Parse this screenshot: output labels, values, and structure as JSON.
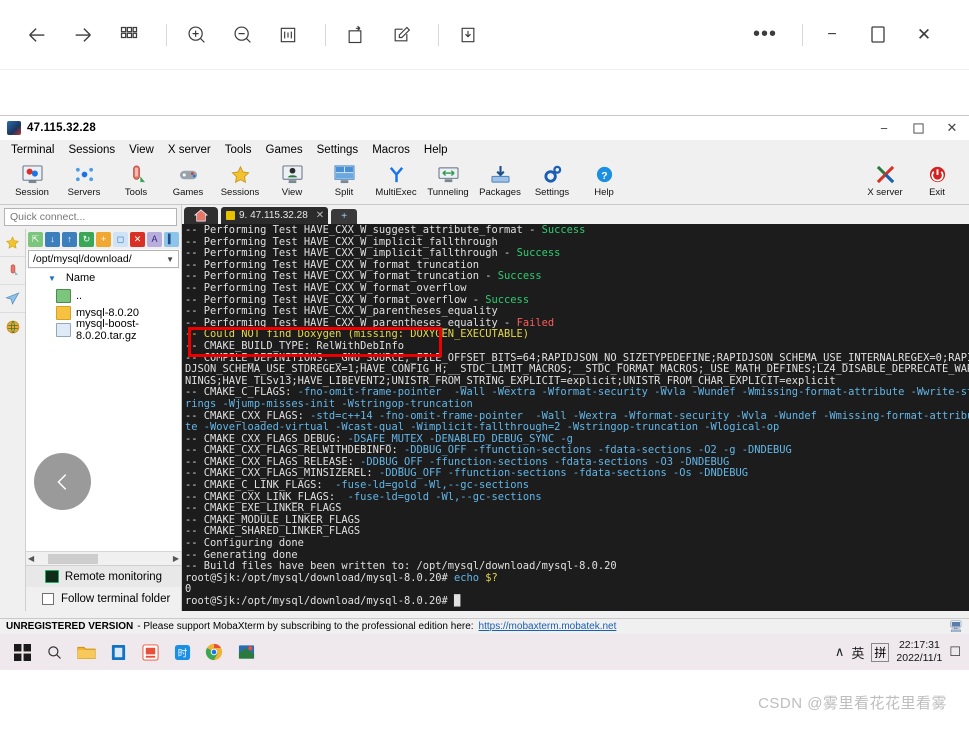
{
  "viewer_toolbar": {
    "icons": [
      {
        "name": "back-icon",
        "glyph": "←"
      },
      {
        "name": "forward-icon",
        "glyph": "→"
      },
      {
        "name": "grid-view-icon",
        "glyph": "grid"
      },
      {
        "name": "zoom-in-icon",
        "glyph": "zoom-in"
      },
      {
        "name": "zoom-out-icon",
        "glyph": "zoom-out"
      },
      {
        "name": "actual-size-icon",
        "glyph": "fit"
      },
      {
        "name": "rotate-icon",
        "glyph": "rotate"
      },
      {
        "name": "edit-icon",
        "glyph": "edit"
      },
      {
        "name": "save-icon",
        "glyph": "download"
      }
    ],
    "more_label": "•••",
    "minimize_label": "−",
    "maximize_label": "❐",
    "close_label": "✕"
  },
  "moba": {
    "window_title": "47.115.32.28",
    "window_controls": {
      "minimize": "−",
      "restore": "❐",
      "close": "✕"
    },
    "menus": [
      "Terminal",
      "Sessions",
      "View",
      "X server",
      "Tools",
      "Games",
      "Settings",
      "Macros",
      "Help"
    ],
    "ribbon": [
      {
        "label": "Session",
        "icon": "session-icon"
      },
      {
        "label": "Servers",
        "icon": "servers-icon"
      },
      {
        "label": "Tools",
        "icon": "tools-icon"
      },
      {
        "label": "Games",
        "icon": "games-icon"
      },
      {
        "label": "Sessions",
        "icon": "sessions-star-icon"
      },
      {
        "label": "View",
        "icon": "view-icon"
      },
      {
        "label": "Split",
        "icon": "split-icon"
      },
      {
        "label": "MultiExec",
        "icon": "multiexec-icon"
      },
      {
        "label": "Tunneling",
        "icon": "tunneling-icon"
      },
      {
        "label": "Packages",
        "icon": "packages-icon"
      },
      {
        "label": "Settings",
        "icon": "settings-gear-icon"
      },
      {
        "label": "Help",
        "icon": "help-icon"
      }
    ],
    "ribbon_right": [
      {
        "label": "X server",
        "icon": "xserver-icon"
      },
      {
        "label": "Exit",
        "icon": "exit-power-icon"
      }
    ]
  },
  "sidebar": {
    "quick_connect_placeholder": "Quick connect...",
    "vertical_tabs": [
      {
        "name": "bookmarks-star-icon",
        "glyph": "★"
      },
      {
        "name": "tools-thermometer-icon",
        "glyph": "⌇"
      },
      {
        "name": "sftp-plane-icon",
        "glyph": "➤"
      },
      {
        "name": "globe-icon",
        "glyph": "●"
      }
    ],
    "sftp_tool_icons": [
      {
        "name": "up-folder-icon",
        "color": "#4caf50"
      },
      {
        "name": "download-icon",
        "color": "#2b6cb0"
      },
      {
        "name": "upload-icon",
        "color": "#2b6cb0"
      },
      {
        "name": "refresh-icon",
        "color": "#3aa757"
      },
      {
        "name": "new-folder-icon",
        "color": "#f0a830"
      },
      {
        "name": "new-file-icon",
        "color": "#cfe3f7"
      },
      {
        "name": "delete-icon",
        "color": "#d93025"
      },
      {
        "name": "text-mode-icon",
        "color": "#8e7cc3"
      },
      {
        "name": "binary-mode-icon",
        "color": "#5b9bd5"
      }
    ],
    "path": "/opt/mysql/download/",
    "column_header": "Name",
    "files": [
      {
        "name": "..",
        "type": "parent"
      },
      {
        "name": "mysql-8.0.20",
        "type": "folder"
      },
      {
        "name": "mysql-boost-8.0.20.tar.gz",
        "type": "archive"
      }
    ],
    "remote_monitoring_label": "Remote monitoring",
    "follow_terminal_folder_label": "Follow terminal folder",
    "follow_terminal_folder_checked": false,
    "back_button_glyph": "‹"
  },
  "terminal": {
    "tab_label": "9. 47.115.32.28",
    "tab_close": "✕",
    "tab_add": "+",
    "lines": [
      [
        {
          "t": "-- Performing Test HAVE_CXX_W_suggest_attribute_format - ",
          "c": ""
        },
        {
          "t": "Success",
          "c": "g"
        }
      ],
      [
        {
          "t": "-- Performing Test HAVE_CXX_W_implicit_fallthrough",
          "c": ""
        }
      ],
      [
        {
          "t": "-- Performing Test HAVE_CXX_W_implicit_fallthrough - ",
          "c": ""
        },
        {
          "t": "Success",
          "c": "g"
        }
      ],
      [
        {
          "t": "-- Performing Test HAVE_CXX_W_format_truncation",
          "c": ""
        }
      ],
      [
        {
          "t": "-- Performing Test HAVE_CXX_W_format_truncation - ",
          "c": ""
        },
        {
          "t": "Success",
          "c": "g"
        }
      ],
      [
        {
          "t": "-- Performing Test HAVE_CXX_W_format_overflow",
          "c": ""
        }
      ],
      [
        {
          "t": "-- Performing Test HAVE_CXX_W_format_overflow - ",
          "c": ""
        },
        {
          "t": "Success",
          "c": "g"
        }
      ],
      [
        {
          "t": "-- Performing Test HAVE_CXX_W_parentheses_equality",
          "c": ""
        }
      ],
      [
        {
          "t": "-- Performing Test HAVE_CXX_W_parentheses_equality - ",
          "c": ""
        },
        {
          "t": "Failed",
          "c": "r"
        }
      ],
      [
        {
          "t": "-- Could NOT find Doxygen (missing: DOXYGEN_EXECUTABLE)",
          "c": "y"
        }
      ],
      [
        {
          "t": "-- CMAKE_BUILD_TYPE: RelWithDebInfo",
          "c": ""
        }
      ],
      [
        {
          "t": "-- COMPILE_DEFINITIONS: _GNU_SOURCE;_FILE_OFFSET_BITS=64;RAPIDJSON_NO_SIZETYPEDEFINE;RAPIDJSON_SCHEMA_USE_INTERNALREGEX=0;RAPI",
          "c": ""
        }
      ],
      [
        {
          "t": "DJSON_SCHEMA_USE_STDREGEX=1;HAVE_CONFIG_H;__STDC_LIMIT_MACROS;__STDC_FORMAT_MACROS;_USE_MATH_DEFINES;LZ4_DISABLE_DEPRECATE_WAR",
          "c": ""
        }
      ],
      [
        {
          "t": "NINGS;HAVE_TLSv13;HAVE_LIBEVENT2;UNISTR_FROM_STRING_EXPLICIT=explicit;UNISTR_FROM_CHAR_EXPLICIT=explicit",
          "c": ""
        }
      ],
      [
        {
          "t": "-- CMAKE_C_FLAGS: ",
          "c": ""
        },
        {
          "t": "-fno-omit-frame-pointer  -Wall -Wextra -Wformat-security -Wvla -Wundef -Wmissing-format-attribute -Wwrite-st",
          "c": "c"
        }
      ],
      [
        {
          "t": "rings -Wjump-misses-init -Wstringop-truncation",
          "c": "c"
        }
      ],
      [
        {
          "t": "-- CMAKE_CXX_FLAGS: ",
          "c": ""
        },
        {
          "t": "-std=c++14 -fno-omit-frame-pointer  -Wall -Wextra -Wformat-security -Wvla -Wundef -Wmissing-format-attribu",
          "c": "c"
        }
      ],
      [
        {
          "t": "te -Woverloaded-virtual -Wcast-qual -Wimplicit-fallthrough=2 -Wstringop-truncation -Wlogical-op",
          "c": "c"
        }
      ],
      [
        {
          "t": "-- CMAKE_CXX_FLAGS_DEBUG: ",
          "c": ""
        },
        {
          "t": "-DSAFE_MUTEX -DENABLED_DEBUG_SYNC -g",
          "c": "c"
        }
      ],
      [
        {
          "t": "-- CMAKE_CXX_FLAGS_RELWITHDEBINFO: ",
          "c": ""
        },
        {
          "t": "-DDBUG_OFF -ffunction-sections -fdata-sections -O2 -g -DNDEBUG",
          "c": "c"
        }
      ],
      [
        {
          "t": "-- CMAKE_CXX_FLAGS_RELEASE: ",
          "c": ""
        },
        {
          "t": "-DDBUG_OFF -ffunction-sections -fdata-sections -O3 -DNDEBUG",
          "c": "c"
        }
      ],
      [
        {
          "t": "-- CMAKE_CXX_FLAGS_MINSIZEREL: ",
          "c": ""
        },
        {
          "t": "-DDBUG_OFF -ffunction-sections -fdata-sections -Os -DNDEBUG",
          "c": "c"
        }
      ],
      [
        {
          "t": "-- CMAKE_C_LINK_FLAGS:  ",
          "c": ""
        },
        {
          "t": "-fuse-ld=gold -Wl,--gc-sections",
          "c": "c"
        }
      ],
      [
        {
          "t": "-- CMAKE_CXX_LINK_FLAGS:  ",
          "c": ""
        },
        {
          "t": "-fuse-ld=gold -Wl,--gc-sections",
          "c": "c"
        }
      ],
      [
        {
          "t": "-- CMAKE_EXE_LINKER_FLAGS",
          "c": ""
        }
      ],
      [
        {
          "t": "-- CMAKE_MODULE_LINKER_FLAGS",
          "c": ""
        }
      ],
      [
        {
          "t": "-- CMAKE_SHARED_LINKER_FLAGS",
          "c": ""
        }
      ],
      [
        {
          "t": "-- Configuring done",
          "c": ""
        }
      ],
      [
        {
          "t": "-- Generating done",
          "c": ""
        }
      ],
      [
        {
          "t": "-- Build files have been written to: /opt/mysql/download/mysql-8.0.20",
          "c": ""
        }
      ],
      [
        {
          "t": "root@Sjk:/opt/mysql/download/mysql-8.0.20# ",
          "c": ""
        },
        {
          "t": "echo ",
          "c": "c"
        },
        {
          "t": "$?",
          "c": "y"
        }
      ],
      [
        {
          "t": "0",
          "c": ""
        }
      ],
      [
        {
          "t": "root@Sjk:/opt/mysql/download/mysql-8.0.20# ",
          "c": ""
        },
        {
          "t": "█",
          "c": ""
        }
      ]
    ],
    "highlight_note": "CMAKE_BUILD_TYPE: RelWithDebInfo",
    "highlight_color": "#ee0000"
  },
  "status_bar": {
    "unregistered_label": "UNREGISTERED VERSION",
    "message": "- Please support MobaXterm by subscribing to the professional edition here:",
    "link": "https://mobaxterm.mobatek.net"
  },
  "taskbar": {
    "buttons": [
      {
        "name": "start-button",
        "glyph": "⊞"
      },
      {
        "name": "search-button",
        "glyph": "⚲"
      },
      {
        "name": "file-explorer-button",
        "glyph": "▬"
      },
      {
        "name": "microsoft-store-button",
        "glyph": "▮"
      },
      {
        "name": "app-red-button",
        "glyph": "▣"
      },
      {
        "name": "dictionary-button",
        "glyph": "词"
      },
      {
        "name": "chrome-button",
        "glyph": "◉"
      },
      {
        "name": "mobaxterm-button",
        "glyph": "◨"
      }
    ],
    "ime_caret": "∧",
    "ime_lang": "英",
    "ime_mode": "拼",
    "time": "22:17:31",
    "date": "2022/11/1",
    "notification_glyph": "☐"
  },
  "watermark": "CSDN @雾里看花花里看雾"
}
